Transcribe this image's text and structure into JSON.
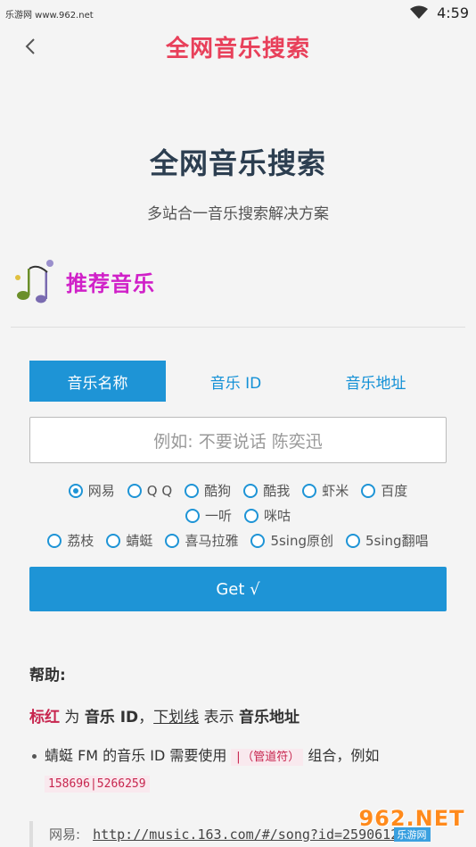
{
  "watermark": {
    "top_text": "乐游网 www.962.net",
    "corner_big": "962.NET",
    "corner_small": "乐游网"
  },
  "status": {
    "time": "4:59"
  },
  "appbar": {
    "title": "全网音乐搜索"
  },
  "hero": {
    "title": "全网音乐搜索",
    "subtitle": "多站合一音乐搜索解决方案"
  },
  "recommend": {
    "label": "推荐音乐"
  },
  "tabs": [
    {
      "label": "音乐名称",
      "active": true
    },
    {
      "label": "音乐 ID",
      "active": false
    },
    {
      "label": "音乐地址",
      "active": false
    }
  ],
  "search": {
    "placeholder": "例如: 不要说话 陈奕迅",
    "value": ""
  },
  "sources": {
    "row1": [
      "网易",
      "Q Q",
      "酷狗",
      "酷我",
      "虾米",
      "百度"
    ],
    "row2": [
      "一听",
      "咪咕"
    ],
    "row3": [
      "荔枝",
      "蜻蜓",
      "喜马拉雅",
      "5sing原创",
      "5sing翻唱"
    ],
    "selected": "网易"
  },
  "get_button": "Get √",
  "help": {
    "title": "帮助:",
    "red_label": "标红",
    "t1": " 为 ",
    "music_id": "音乐 ID",
    "t2": "，",
    "underline_label": "下划线",
    "t3": " 表示 ",
    "music_url": "音乐地址",
    "bullet_text": "蜻蜓 FM 的音乐 ID 需要使用 ",
    "pipe_code": "|（管道符）",
    "bullet_text2": " 组合，例如 ",
    "example_code": "158696|5266259",
    "quote_label": "网易:",
    "quote_link": "http://music.163.com/#/song?id=25906124"
  }
}
